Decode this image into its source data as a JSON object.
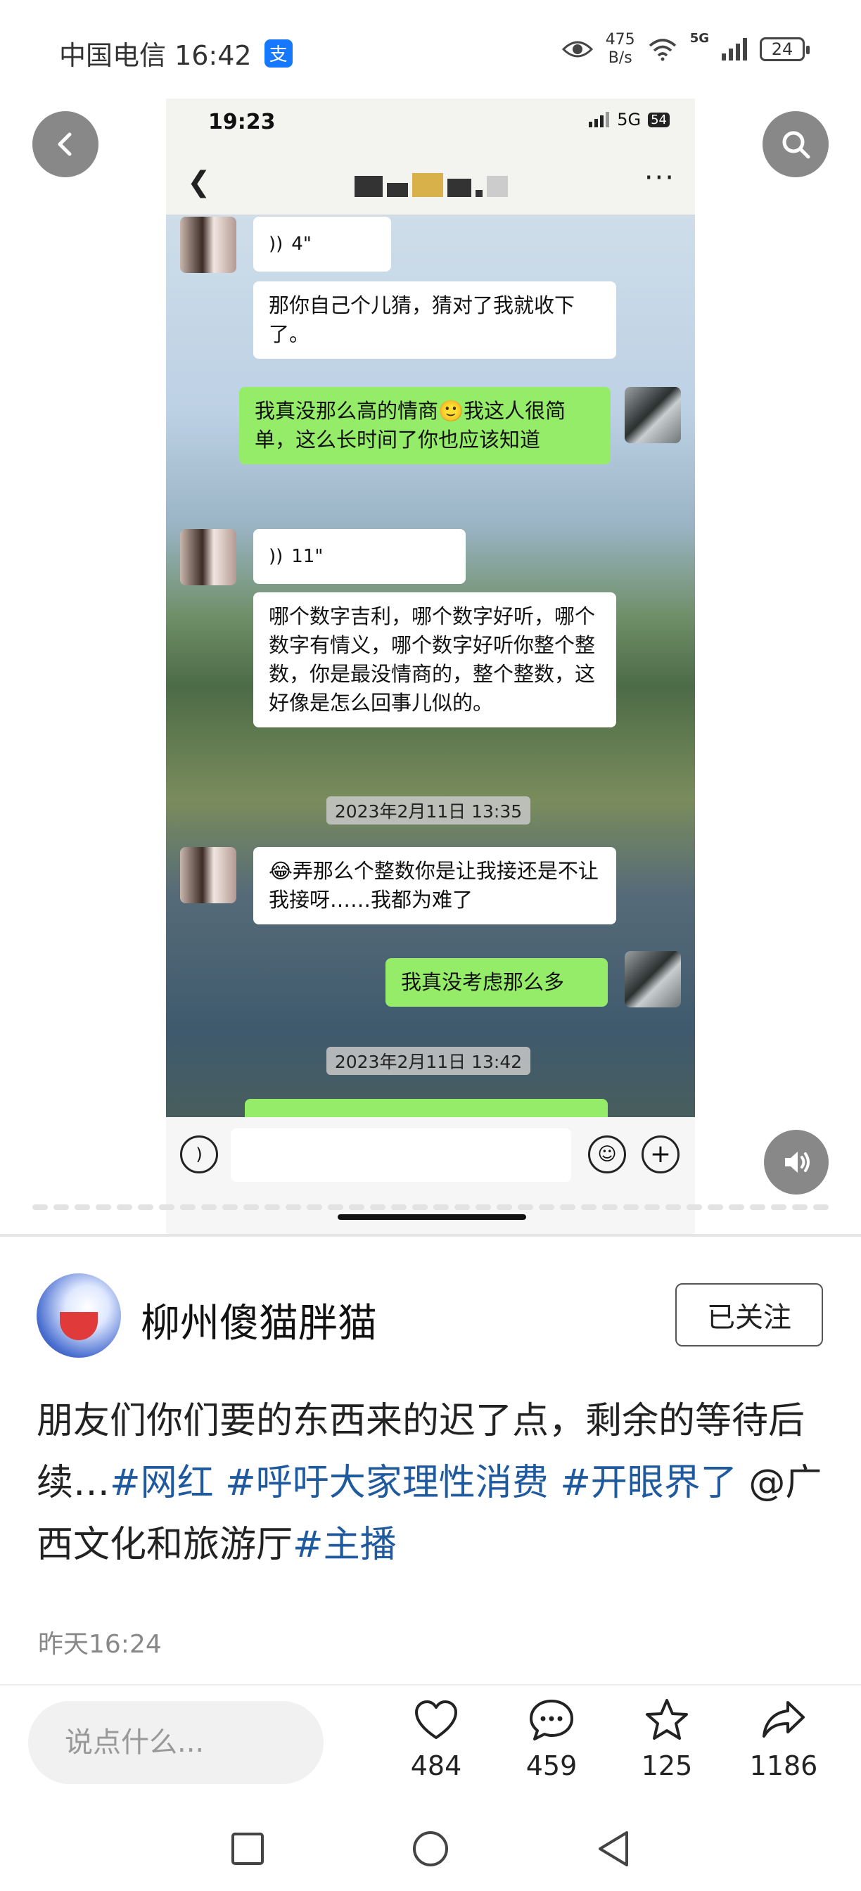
{
  "status_bar": {
    "carrier_time": "中国电信 16:42",
    "alipay_badge": "支",
    "speed_value": "475",
    "speed_unit": "B/s",
    "network": "5G",
    "battery": "24"
  },
  "embedded_chat": {
    "status_time": "19:23",
    "status_network": "5G",
    "status_battery": "54",
    "messages": [
      {
        "side": "left",
        "type": "voice",
        "duration": "4\""
      },
      {
        "side": "left",
        "type": "text",
        "text": "那你自己个儿猜，猜对了我就收下了。"
      },
      {
        "side": "right",
        "type": "text",
        "text": "我真没那么高的情商🙂我这人很简单，这么长时间了你也应该知道"
      },
      {
        "side": "left",
        "type": "voice",
        "duration": "11\""
      },
      {
        "side": "left",
        "type": "text",
        "text": "哪个数字吉利，哪个数字好听，哪个数字有情义，哪个数字好听你整个整数，你是最没情商的，整个整数，这好像是怎么回事儿似的。"
      },
      {
        "side": "center",
        "type": "timestamp",
        "text": "2023年2月11日 13:35"
      },
      {
        "side": "left",
        "type": "text",
        "text": "😂弄那么个整数你是让我接还是不让我接呀……我都为难了"
      },
      {
        "side": "right",
        "type": "text",
        "text": "我真没考虑那么多"
      },
      {
        "side": "center",
        "type": "timestamp",
        "text": "2023年2月11日 13:42"
      }
    ]
  },
  "post": {
    "author_name": "柳州傻猫胖猫",
    "follow_label": "已关注",
    "text_plain": "朋友们你们要的东西来的迟了点，剩余的等待后续…",
    "tag_1": "#网红",
    "tag_2": "#呼吁大家理性消费",
    "tag_3": "#开眼界了",
    "mention": " @广西文化和旅游厅",
    "tag_4": "#主播",
    "time": "昨天16:24"
  },
  "actions": {
    "comment_placeholder": "说点什么...",
    "like_count": "484",
    "comment_count": "459",
    "favorite_count": "125",
    "share_count": "1186"
  },
  "colors": {
    "hashtag": "#1f5a9e",
    "chat_green": "#95ec69",
    "alipay": "#1677ff"
  }
}
